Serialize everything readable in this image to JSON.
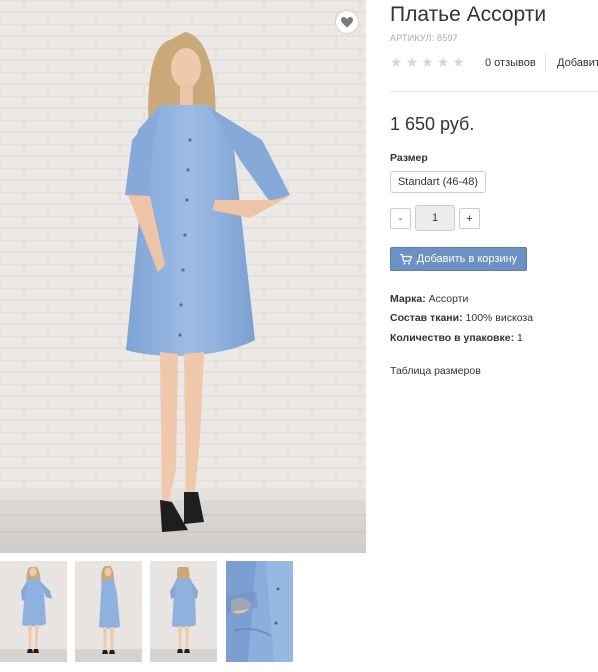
{
  "product": {
    "title": "Платье Ассорти",
    "sku": "АРТИКУЛ: 8597",
    "rating_stars": 0,
    "reviews_label": "0 отзывов",
    "add_review_label": "Добавит",
    "price": "1 650 руб.",
    "size_label": "Размер",
    "size_option": "Standart (46-48)",
    "quantity": "1",
    "qty_minus_label": "-",
    "qty_plus_label": "+",
    "add_to_cart_label": "Добавить в корзину",
    "attributes": [
      {
        "name": "Марка:",
        "value": "Ассорти"
      },
      {
        "name": "Состав ткани:",
        "value": "100% вискоза"
      },
      {
        "name": "Количество в упаковке:",
        "value": "1"
      }
    ],
    "size_table_label": "Таблица размеров"
  },
  "icons": {
    "favorite": "heart-icon",
    "cart": "cart-icon",
    "rating": "star-icon"
  },
  "colors": {
    "accent": "#6d91c4",
    "dress": "#8eb1df",
    "wall": "#ece9e6",
    "star_empty": "#d7d7d7"
  },
  "gallery": {
    "thumbnail_count": 4
  }
}
